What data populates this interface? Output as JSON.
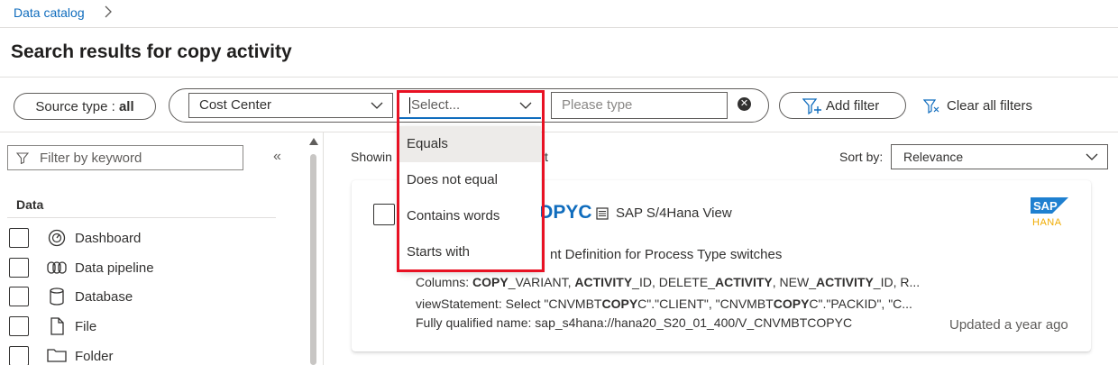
{
  "breadcrumb": {
    "root": "Data catalog"
  },
  "page": {
    "title": "Search results for copy activity"
  },
  "filters": {
    "source_type_label": "Source type : ",
    "source_type_value": "all",
    "attribute": "Cost Center",
    "operator_placeholder": "Select...",
    "value_placeholder": "Please type",
    "add_filter": "Add filter",
    "clear_all": "Clear all filters"
  },
  "operator_dropdown": {
    "options": [
      "Equals",
      "Does not equal",
      "Contains words",
      "Starts with"
    ],
    "hovered_index": 0
  },
  "sidebar": {
    "keyword_placeholder": "Filter by keyword",
    "collapse_glyph": "«",
    "section": "Data",
    "items": [
      {
        "label": "Dashboard",
        "icon": "dashboard-icon"
      },
      {
        "label": "Data pipeline",
        "icon": "data-pipeline-icon"
      },
      {
        "label": "Database",
        "icon": "database-icon"
      },
      {
        "label": "File",
        "icon": "file-icon"
      },
      {
        "label": "Folder",
        "icon": "folder-icon"
      }
    ]
  },
  "results": {
    "showing_prefix": "Showin",
    "showing_suffix": "t",
    "sort_label": "Sort by:",
    "sort_value": "Relevance"
  },
  "card": {
    "title_visible": "OPYC",
    "type": "SAP S/4Hana View",
    "description_visible": "nt Definition for Process Type switches",
    "columns_label": "Columns: ",
    "columns_parts": [
      "COPY",
      "_VARIANT, ",
      "ACTIVITY",
      "_ID, DELETE_",
      "ACTIVITY",
      ", NEW_",
      "ACTIVITY",
      "_ID, R..."
    ],
    "view_label": "viewStatement: Select \"CNVMBT",
    "view_parts": [
      "COPY",
      "C\".\"CLIENT\", \"CNVMBT",
      "COPY",
      "C\".\"PACKID\", \"C..."
    ],
    "fqn": "Fully qualified name: sap_s4hana://hana20_S20_01_400/V_CNVMBTCOPYC",
    "updated": "Updated a year ago",
    "logo_text": "SAP",
    "logo_sub": "HANA"
  },
  "colors": {
    "accent": "#0f6cbd",
    "highlight": "#e81123",
    "sap_blue": "#1f80d0",
    "hana": "#f0ab00"
  }
}
